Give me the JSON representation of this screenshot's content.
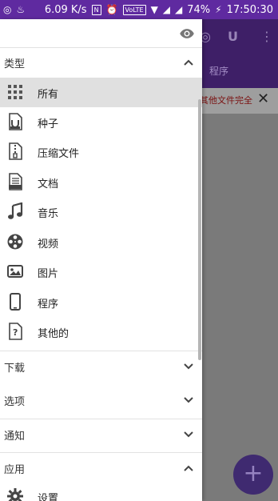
{
  "status_bar": {
    "speed": "6.09 K/s",
    "volte": "VoLTE",
    "battery": "74%",
    "time": "17:50:30"
  },
  "background_app": {
    "tab_label": "程序",
    "banner_text": "其他文件完全",
    "close_icon": "close-icon",
    "fab_icon": "plus-icon"
  },
  "drawer": {
    "types_section": {
      "title": "类型",
      "expanded": true
    },
    "type_items": [
      {
        "label": "所有",
        "icon": "grid-icon",
        "selected": true
      },
      {
        "label": "种子",
        "icon": "torrent-file-icon"
      },
      {
        "label": "压缩文件",
        "icon": "zip-file-icon"
      },
      {
        "label": "文档",
        "icon": "doc-file-icon"
      },
      {
        "label": "音乐",
        "icon": "music-note-icon"
      },
      {
        "label": "视频",
        "icon": "film-reel-icon"
      },
      {
        "label": "图片",
        "icon": "photo-icon"
      },
      {
        "label": "程序",
        "icon": "phone-icon"
      },
      {
        "label": "其他的",
        "icon": "unknown-file-icon"
      }
    ],
    "sections": [
      {
        "title": "下载",
        "expanded": false
      },
      {
        "title": "选项",
        "expanded": false
      },
      {
        "title": "通知",
        "expanded": false
      },
      {
        "title": "应用",
        "expanded": true
      }
    ],
    "app_items": [
      {
        "label": "设置",
        "icon": "gear-icon"
      }
    ]
  },
  "colors": {
    "status_bar": "#5f2aa0",
    "app_bar": "#3e1f67",
    "selected_row": "#e0e0e0",
    "icon_dark": "#444444"
  }
}
